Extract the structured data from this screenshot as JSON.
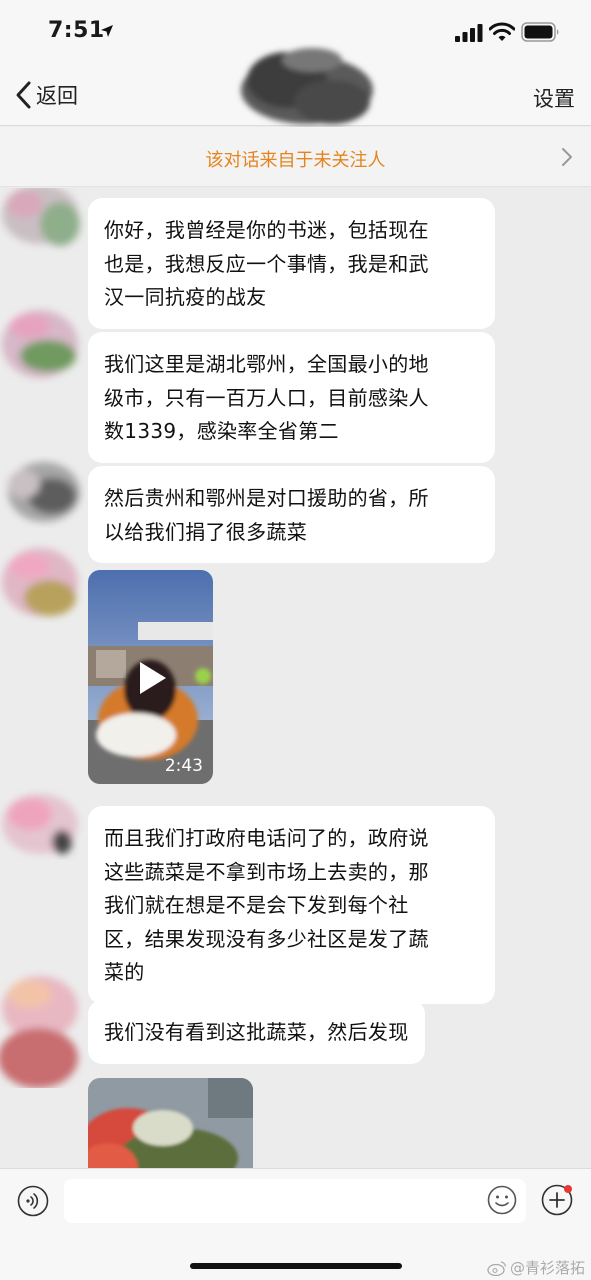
{
  "status_bar": {
    "time": "7:51"
  },
  "nav": {
    "back_label": "返回",
    "settings_label": "设置"
  },
  "notice": {
    "text": "该对话来自于未关注人"
  },
  "messages": [
    {
      "type": "text",
      "text": "你好，我曾经是你的书迷，包括现在\n也是，我想反应一个事情，我是和武\n汉一同抗疫的战友"
    },
    {
      "type": "text",
      "text": "我们这里是湖北鄂州，全国最小的地\n级市，只有一百万人口，目前感染人\n数1339，感染率全省第二"
    },
    {
      "type": "text",
      "text": "然后贵州和鄂州是对口援助的省，所\n以给我们捐了很多蔬菜"
    },
    {
      "type": "video",
      "duration": "2:43"
    },
    {
      "type": "text",
      "text": "而且我们打政府电话问了的，政府说\n这些蔬菜是不拿到市场上去卖的，那\n我们就在想是不是会下发到每个社\n区，结果发现没有多少社区是发了蔬\n菜的"
    },
    {
      "type": "text",
      "text": "我们没有看到这批蔬菜，然后发现"
    },
    {
      "type": "image"
    }
  ],
  "watermark": {
    "text": "@青衫落拓"
  },
  "colors": {
    "notice": "#e5841e",
    "background": "#ececec",
    "bubble": "#ffffff",
    "badge": "#e53935"
  },
  "icons": [
    "location-arrow-icon",
    "signal-icon",
    "wifi-icon",
    "battery-icon",
    "back-chevron-icon",
    "chevron-right-icon",
    "play-icon",
    "voice-icon",
    "emoji-icon",
    "plus-icon",
    "weibo-icon"
  ]
}
